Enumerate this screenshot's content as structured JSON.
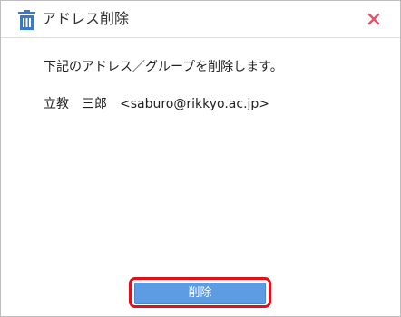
{
  "dialog": {
    "title": "アドレス削除",
    "title_icon": "trash-icon",
    "close_icon": "close-icon",
    "message": "下記のアドレス／グループを削除します。",
    "recipient": {
      "name": "立教　三郎",
      "email": "<saburo@rikkyo.ac.jp>"
    },
    "delete_label": "削除"
  },
  "colors": {
    "accent_blue": "#4a86cf",
    "button_fill": "#5d9be2",
    "close_red": "#e0556a",
    "highlight_red": "#e0101a"
  }
}
